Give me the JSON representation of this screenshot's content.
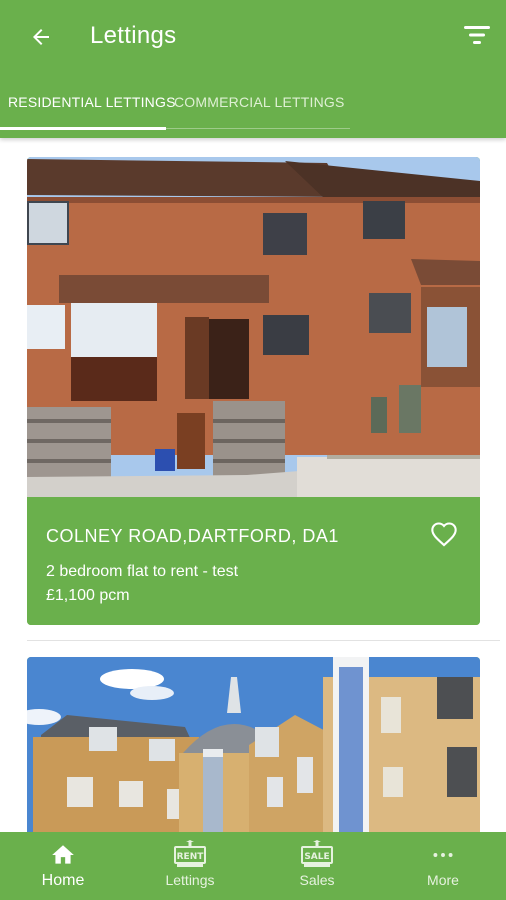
{
  "header": {
    "title": "Lettings",
    "back_icon": "arrow-left-icon",
    "filter_icon": "filter-icon"
  },
  "tabs": [
    {
      "label": "RESIDENTIAL LETTINGS",
      "active": true
    },
    {
      "label": "COMMERCIAL LETTINGS",
      "active": false
    }
  ],
  "listings": [
    {
      "address": "COLNEY ROAD,DARTFORD, DA1",
      "description": "2 bedroom flat to rent - test",
      "price": "£1,100 pcm",
      "favorite": false
    }
  ],
  "bottom_nav": [
    {
      "label": "Home",
      "icon": "home-icon",
      "active": true
    },
    {
      "label": "Lettings",
      "icon": "rent-sign-icon",
      "active": false
    },
    {
      "label": "Sales",
      "icon": "sale-sign-icon",
      "active": false
    },
    {
      "label": "More",
      "icon": "more-dots-icon",
      "active": false
    }
  ],
  "colors": {
    "primary": "#6ab04c",
    "white": "#ffffff"
  }
}
